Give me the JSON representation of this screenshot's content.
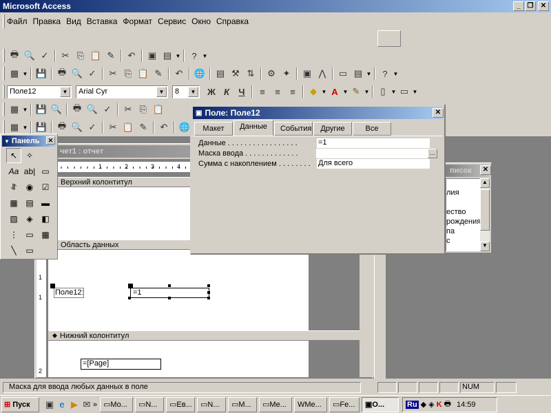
{
  "app": {
    "title": "Microsoft Access"
  },
  "menu": [
    "Файл",
    "Правка",
    "Вид",
    "Вставка",
    "Формат",
    "Сервис",
    "Окно",
    "Справка"
  ],
  "format_bar": {
    "control": "Поле12",
    "font": "Arial Cyr",
    "size": "8",
    "bold": "Ж",
    "italic": "К",
    "underline": "Ч"
  },
  "report_window": {
    "title": "Отчет1 : отчет",
    "title_visible": "чет1 : отчет",
    "sections": {
      "header": "Верхний колонтитул",
      "detail": "Область данных",
      "footer": "Нижний колонтитул"
    },
    "controls": {
      "label": "Поле12:",
      "textbox": "=1",
      "page": "=[Page]"
    }
  },
  "properties": {
    "title": "Поле: Поле12",
    "tabs": [
      "Макет",
      "Данные",
      "События",
      "Другие",
      "Все"
    ],
    "active_tab": "Данные",
    "rows": [
      {
        "label": "Данные . . . . . . . . . . . . . . . . .",
        "value": "=1"
      },
      {
        "label": "Маска ввода . . . . . . . . . . . . .",
        "value": ""
      },
      {
        "label": "Сумма с накоплением . . . . . . . .",
        "value": "Для всего"
      }
    ]
  },
  "toolbox": {
    "title": "Панель"
  },
  "field_list": {
    "title_visible": "писок",
    "items": [
      "лия",
      "",
      "ество",
      "рождения",
      "па",
      "с"
    ]
  },
  "statusbar": {
    "text": "Маска для ввода любых данных в поле",
    "num": "NUM"
  },
  "taskbar": {
    "start": "Пуск",
    "tasks": [
      "Mo...",
      "N...",
      "Ев...",
      "N...",
      "M...",
      "Me...",
      "Me...",
      "Fe...",
      "О..."
    ],
    "clock": "14:59",
    "lang": "Ru"
  },
  "ruler_nums": [
    "1",
    "2",
    "3",
    "4",
    "5"
  ],
  "vruler_nums": [
    "1",
    "1",
    "2",
    "1",
    "1"
  ]
}
